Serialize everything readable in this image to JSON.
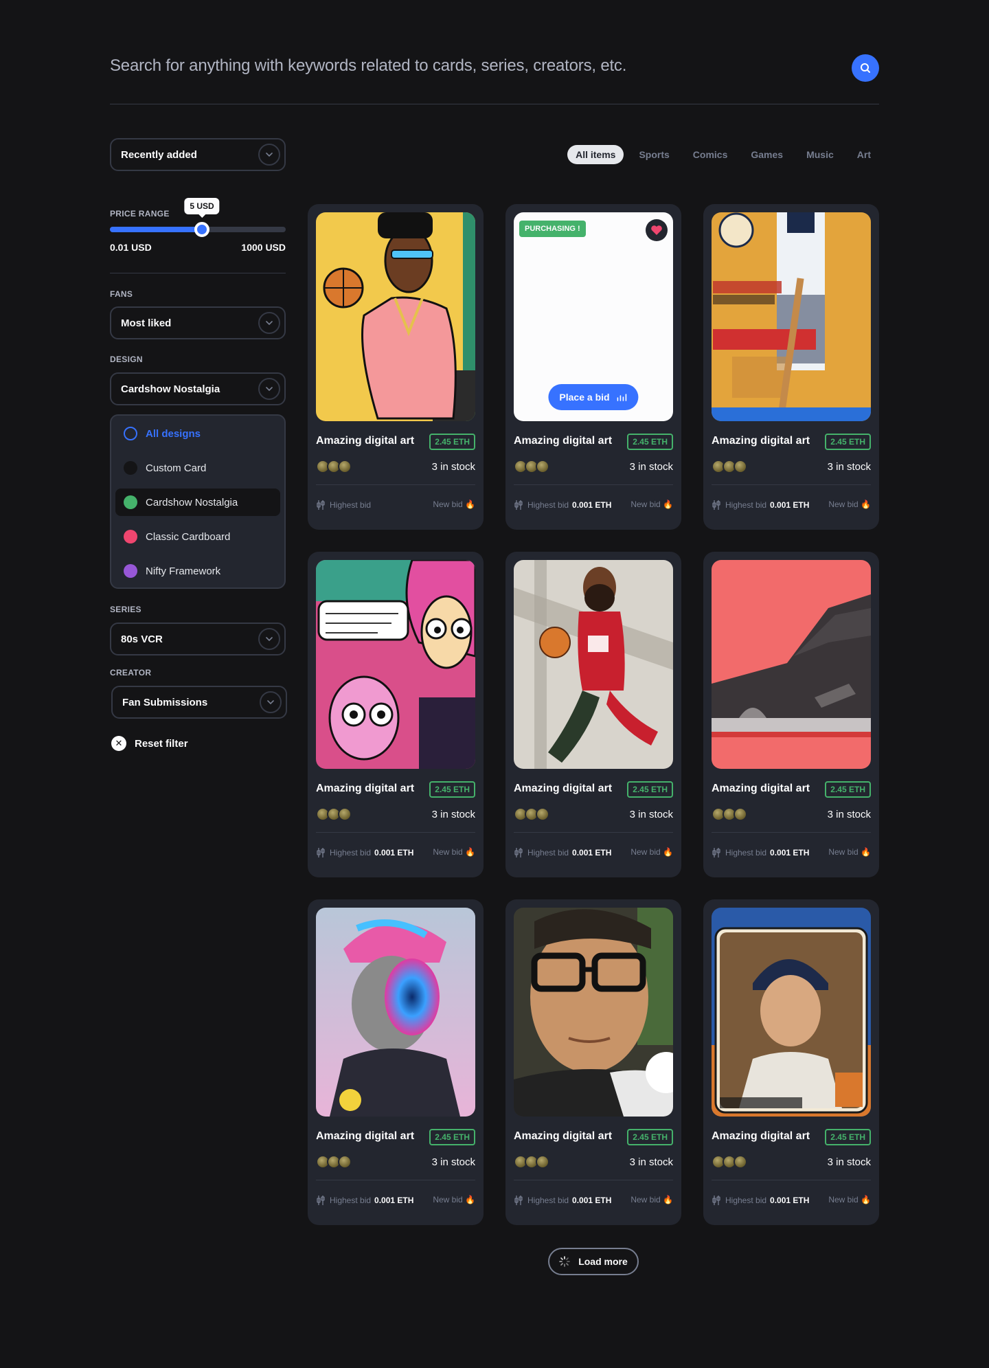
{
  "search": {
    "placeholder": "Search for anything with keywords related to cards, series, creators, etc.",
    "button_icon": "search-icon"
  },
  "sort": {
    "selected": "Recently added"
  },
  "tabs": [
    {
      "label": "All items",
      "active": true
    },
    {
      "label": "Sports",
      "active": false
    },
    {
      "label": "Comics",
      "active": false
    },
    {
      "label": "Games",
      "active": false
    },
    {
      "label": "Music",
      "active": false
    },
    {
      "label": "Art",
      "active": false
    }
  ],
  "filters": {
    "price_range": {
      "label": "PRICE RANGE",
      "tooltip": "5 USD",
      "min_label": "0.01 USD",
      "max_label": "1000 USD",
      "level_fraction": 0.525
    },
    "fans": {
      "label": "FANS",
      "selected": "Most liked"
    },
    "design": {
      "label": "DESIGN",
      "selected": "Cardshow Nostalgia",
      "options": [
        {
          "label": "All designs",
          "color": "#3772ff",
          "style": "ring"
        },
        {
          "label": "Custom Card",
          "color": "#141416",
          "style": "dot"
        },
        {
          "label": "Cardshow Nostalgia",
          "color": "#45b26b",
          "style": "dot"
        },
        {
          "label": "Classic Cardboard",
          "color": "#ef466f",
          "style": "dot"
        },
        {
          "label": "Nifty Framework",
          "color": "#9757d7",
          "style": "dot"
        }
      ]
    },
    "series": {
      "label": "SERIES",
      "selected": "80s VCR"
    },
    "creator": {
      "label": "CREATOR",
      "selected": "Fan Submissions"
    },
    "reset": "Reset filter"
  },
  "cards": [
    {
      "name": "Amazing digital art",
      "price": "2.45 ETH",
      "stock": "3 in stock",
      "bid_label": "Highest bid",
      "bid_value": "",
      "new_bid": "New bid",
      "art": "basketball-player-art"
    },
    {
      "name": "Amazing digital art",
      "price": "2.45 ETH",
      "stock": "3 in stock",
      "bid_label": "Highest bid",
      "bid_value": "0.001 ETH",
      "new_bid": "New bid",
      "art": "blank",
      "badge": "PURCHASING !",
      "place_bid": "Place a bid"
    },
    {
      "name": "Amazing digital art",
      "price": "2.45 ETH",
      "stock": "3 in stock",
      "bid_label": "Highest bid",
      "bid_value": "0.001 ETH",
      "new_bid": "New bid",
      "art": "tigers-poster-art"
    },
    {
      "name": "Amazing digital art",
      "price": "2.45 ETH",
      "stock": "3 in stock",
      "bid_label": "Highest bid",
      "bid_value": "0.001 ETH",
      "new_bid": "New bid",
      "art": "comic-art"
    },
    {
      "name": "Amazing digital art",
      "price": "2.45 ETH",
      "stock": "3 in stock",
      "bid_label": "Highest bid",
      "bid_value": "0.001 ETH",
      "new_bid": "New bid",
      "art": "rockets-player-art"
    },
    {
      "name": "Amazing digital art",
      "price": "2.45 ETH",
      "stock": "3 in stock",
      "bid_label": "Highest bid",
      "bid_value": "0.001 ETH",
      "new_bid": "New bid",
      "art": "sneaker-art"
    },
    {
      "name": "Amazing digital art",
      "price": "2.45 ETH",
      "stock": "3 in stock",
      "bid_label": "Highest bid",
      "bid_value": "0.001 ETH",
      "new_bid": "New bid",
      "art": "vr-portrait-art"
    },
    {
      "name": "Amazing digital art",
      "price": "2.45 ETH",
      "stock": "3 in stock",
      "bid_label": "Highest bid",
      "bid_value": "0.001 ETH",
      "new_bid": "New bid",
      "art": "glasses-portrait-art"
    },
    {
      "name": "Amazing digital art",
      "price": "2.45 ETH",
      "stock": "3 in stock",
      "bid_label": "Highest bid",
      "bid_value": "0.001 ETH",
      "new_bid": "New bid",
      "art": "pitcher-card-art"
    }
  ],
  "load_more": "Load more"
}
